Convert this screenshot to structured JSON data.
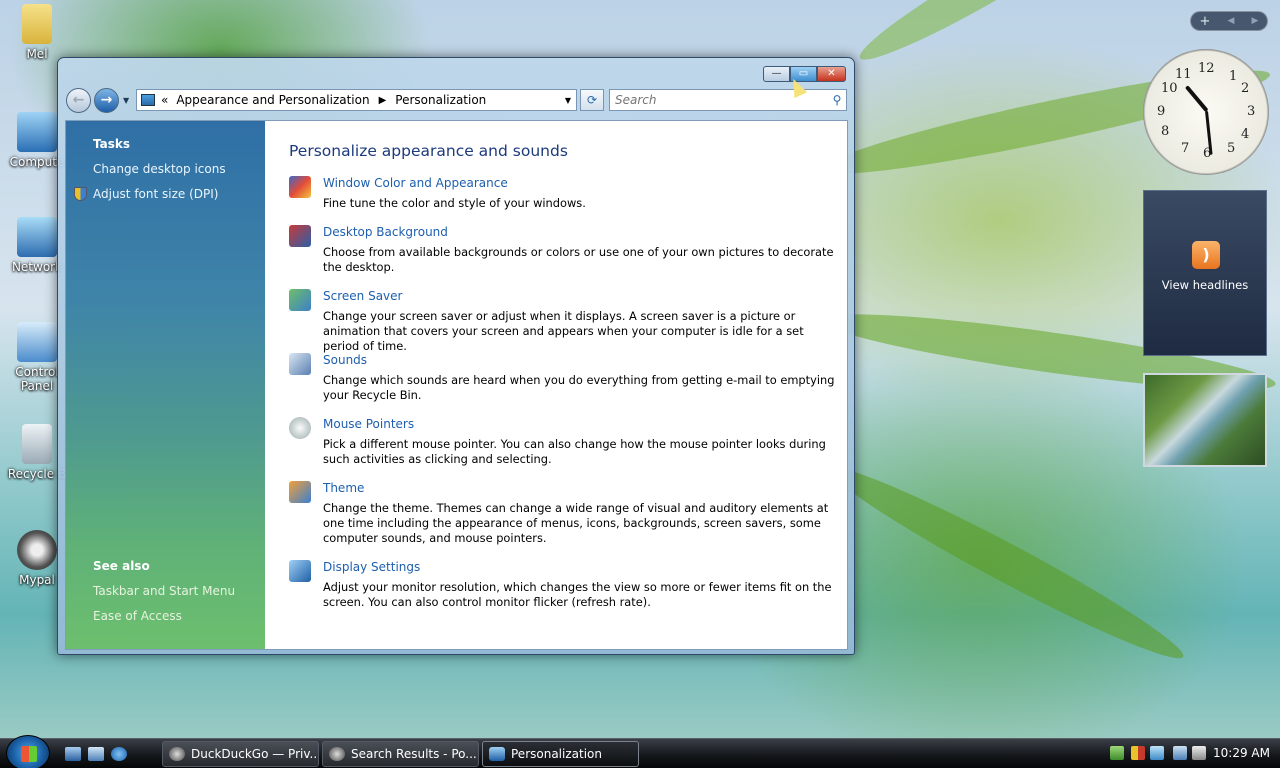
{
  "desktop": {
    "icons": [
      {
        "label": "Mel"
      },
      {
        "label": "Compute"
      },
      {
        "label": "Network"
      },
      {
        "label": "Control Panel"
      },
      {
        "label": "Recycle B"
      },
      {
        "label": "Mypal"
      }
    ]
  },
  "window": {
    "caption": {
      "minimize": "—",
      "maximize": "▭",
      "close": "✕"
    },
    "nav": {
      "back": "←",
      "forward": "→",
      "dropdown": "▼",
      "address": {
        "overflow": "«",
        "crumbs": [
          "Appearance and Personalization",
          "Personalization"
        ],
        "separator": "▶",
        "dropdown": "▼"
      },
      "refresh": "⟳",
      "search": {
        "placeholder": "Search",
        "icon": "⚲"
      }
    },
    "left_pane": {
      "tasks_heading": "Tasks",
      "tasks": [
        "Change desktop icons",
        "Adjust font size (DPI)"
      ],
      "see_also_heading": "See also",
      "see_also": [
        "Taskbar and Start Menu",
        "Ease of Access"
      ]
    },
    "main": {
      "heading": "Personalize appearance and sounds",
      "items": [
        {
          "title": "Window Color and Appearance",
          "desc": "Fine tune the color and style of your windows."
        },
        {
          "title": "Desktop Background",
          "desc": "Choose from available backgrounds or colors or use one of your own pictures to decorate the desktop."
        },
        {
          "title": "Screen Saver",
          "desc": "Change your screen saver or adjust when it displays. A screen saver is a picture or animation that covers your screen and appears when your computer is idle for a set period of time."
        },
        {
          "title": "Sounds",
          "desc": "Change which sounds are heard when you do everything from getting e-mail to emptying your Recycle Bin."
        },
        {
          "title": "Mouse Pointers",
          "desc": "Pick a different mouse pointer. You can also change how the mouse pointer looks during such activities as clicking and selecting."
        },
        {
          "title": "Theme",
          "desc": "Change the theme. Themes can change a wide range of visual and auditory elements at one time including the appearance of menus, icons, backgrounds, screen savers, some computer sounds, and mouse pointers."
        },
        {
          "title": "Display Settings",
          "desc": "Adjust your monitor resolution, which changes the view so more or fewer items fit on the screen. You can also control monitor flicker (refresh rate)."
        }
      ]
    }
  },
  "sidebar": {
    "controls": {
      "add": "+",
      "prev": "◀",
      "next": "▶"
    },
    "clock": {
      "numbers": [
        "12",
        "1",
        "2",
        "3",
        "4",
        "5",
        "6",
        "7",
        "8",
        "9",
        "10",
        "11"
      ]
    },
    "feed": {
      "label": "View headlines"
    }
  },
  "taskbar": {
    "tasks": [
      {
        "label": "DuckDuckGo — Priv..."
      },
      {
        "label": "Search Results - Po..."
      },
      {
        "label": "Personalization"
      }
    ],
    "time": "10:29 AM"
  },
  "colors": {
    "link": "#1d5fae",
    "heading": "#1c3a7c",
    "pane_top": "#2f6fa6",
    "pane_bottom": "#6cbf6d"
  }
}
